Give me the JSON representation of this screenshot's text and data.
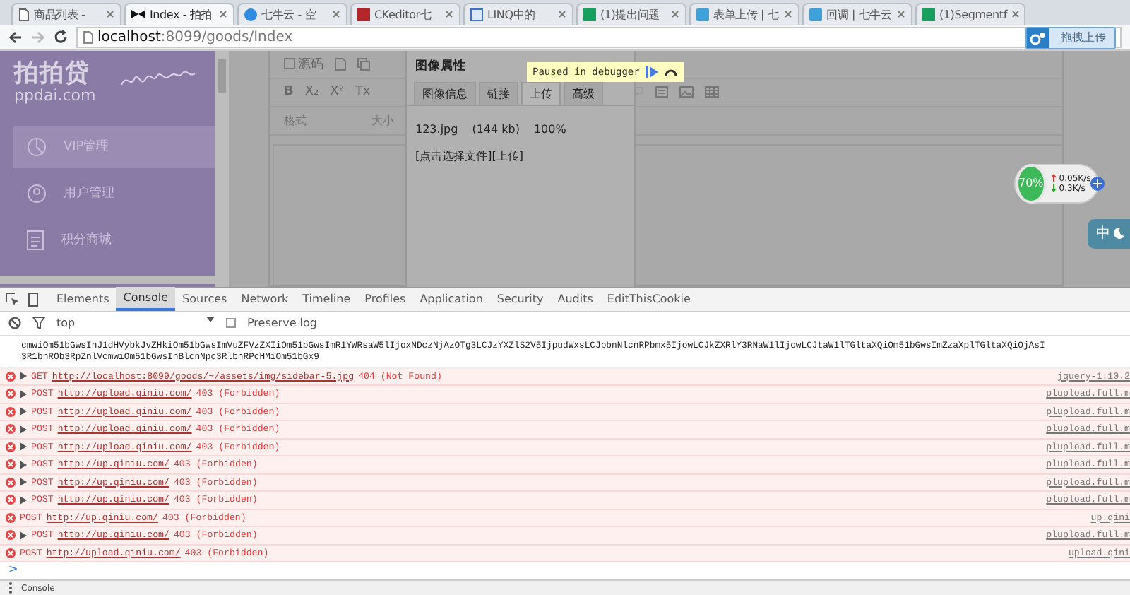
{
  "browser_tabs": [
    {
      "title": "商品列表 -",
      "selected": false,
      "kind": "page"
    },
    {
      "title": "Index - 拍拍",
      "selected": true,
      "kind": "bow"
    },
    {
      "title": "七牛云 - 空",
      "selected": false,
      "kind": "circle"
    },
    {
      "title": "CKeditor七",
      "selected": false,
      "kind": "letter"
    },
    {
      "title": "LINQ中的",
      "selected": false,
      "kind": "square"
    },
    {
      "title": "(1)提出问题",
      "selected": false,
      "kind": "sf"
    },
    {
      "title": "表单上传 | 七",
      "selected": false,
      "kind": "cloud"
    },
    {
      "title": "回调 | 七牛云",
      "selected": false,
      "kind": "cloud"
    },
    {
      "title": "(1)Segmentf",
      "selected": false,
      "kind": "sf"
    }
  ],
  "address_bar": {
    "host": "localhost",
    "rest": ":8099/goods/Index"
  },
  "upload_extension": {
    "label": "拖拽上传"
  },
  "sidebar": {
    "logo": "拍拍贷",
    "logo_sub": "ppdai.com",
    "items": [
      {
        "label": "VIP管理",
        "selected": true,
        "kind": "pie"
      },
      {
        "label": "用户管理",
        "selected": false,
        "kind": "user"
      },
      {
        "label": "积分商城",
        "selected": false,
        "kind": "clipboard"
      }
    ]
  },
  "editor": {
    "source_button": "源码",
    "format_buttons": [
      "B",
      "X₂",
      "X²",
      "Tx"
    ],
    "format_select": "格式",
    "size_select": "大小"
  },
  "dialog": {
    "title": "图像属性",
    "tabs": [
      {
        "label": "图像信息",
        "selected": false
      },
      {
        "label": "链接",
        "selected": false
      },
      {
        "label": "上传",
        "selected": true
      },
      {
        "label": "高级",
        "selected": false
      }
    ],
    "file_name": "123.jpg",
    "file_size": "(144 kb)",
    "progress": "100%",
    "choose": "[点击选择文件][上传]"
  },
  "debugger_badge": {
    "label": "Paused in debugger"
  },
  "speed_widget": {
    "percent": "70%",
    "up": "0.05K/s",
    "down": "0.3K/s"
  },
  "ime_button": {
    "label": "中"
  },
  "devtools": {
    "tabs": [
      {
        "label": "Elements",
        "selected": false
      },
      {
        "label": "Console",
        "selected": true
      },
      {
        "label": "Sources",
        "selected": false
      },
      {
        "label": "Network",
        "selected": false
      },
      {
        "label": "Timeline",
        "selected": false
      },
      {
        "label": "Profiles",
        "selected": false
      },
      {
        "label": "Application",
        "selected": false
      },
      {
        "label": "Security",
        "selected": false
      },
      {
        "label": "Audits",
        "selected": false
      },
      {
        "label": "EditThisCookie",
        "selected": false
      }
    ],
    "context": "top",
    "preserve_log": {
      "label": "Preserve log",
      "checked": false
    },
    "log_text": [
      "cmwiOm51bGwsInJ1dHVybkJvZHkiOm51bGwsImVuZFVzZXIiOm51bGwsImR1YWRsaW5lIjoxNDczNjAzOTg3LCJzYXZlS2V5IjpudWxsLCJpbnNlcnRPbmx5IjowLCJkZXRlY3RNaW1lIjowLCJtaW1lTGltaXQiOm51bGwsImZzaXplTGltaXQiOjAsI",
      "3R1bnROb3RpZnlVcmwiOm51bGwsInBlcnNpc3RlbnRPcHMiOm51bGx9"
    ],
    "errors": [
      {
        "expandable": true,
        "method": "GET",
        "url": "http://localhost:8099/goods/~/assets/img/sidebar-5.jpg",
        "status": "404 (Not Found)",
        "source": "jquery-1.10.2"
      },
      {
        "expandable": true,
        "method": "POST",
        "url": "http://upload.qiniu.com/",
        "status": "403 (Forbidden)",
        "source": "plupload.full.m"
      },
      {
        "expandable": true,
        "method": "POST",
        "url": "http://upload.qiniu.com/",
        "status": "403 (Forbidden)",
        "source": "plupload.full.m"
      },
      {
        "expandable": true,
        "method": "POST",
        "url": "http://upload.qiniu.com/",
        "status": "403 (Forbidden)",
        "source": "plupload.full.m"
      },
      {
        "expandable": true,
        "method": "POST",
        "url": "http://upload.qiniu.com/",
        "status": "403 (Forbidden)",
        "source": "plupload.full.m"
      },
      {
        "expandable": true,
        "method": "POST",
        "url": "http://up.qiniu.com/",
        "status": "403 (Forbidden)",
        "source": "plupload.full.m"
      },
      {
        "expandable": true,
        "method": "POST",
        "url": "http://up.qiniu.com/",
        "status": "403 (Forbidden)",
        "source": "plupload.full.m"
      },
      {
        "expandable": true,
        "method": "POST",
        "url": "http://up.qiniu.com/",
        "status": "403 (Forbidden)",
        "source": "plupload.full.m"
      },
      {
        "expandable": false,
        "method": "POST",
        "url": "http://up.qiniu.com/",
        "status": "403 (Forbidden)",
        "source": "up.qini"
      },
      {
        "expandable": true,
        "method": "POST",
        "url": "http://up.qiniu.com/",
        "status": "403 (Forbidden)",
        "source": "plupload.full.m"
      },
      {
        "expandable": false,
        "method": "POST",
        "url": "http://upload.qiniu.com/",
        "status": "403 (Forbidden)",
        "source": "upload.qini"
      }
    ],
    "prompt": ">",
    "drawer_tab": "Console"
  }
}
